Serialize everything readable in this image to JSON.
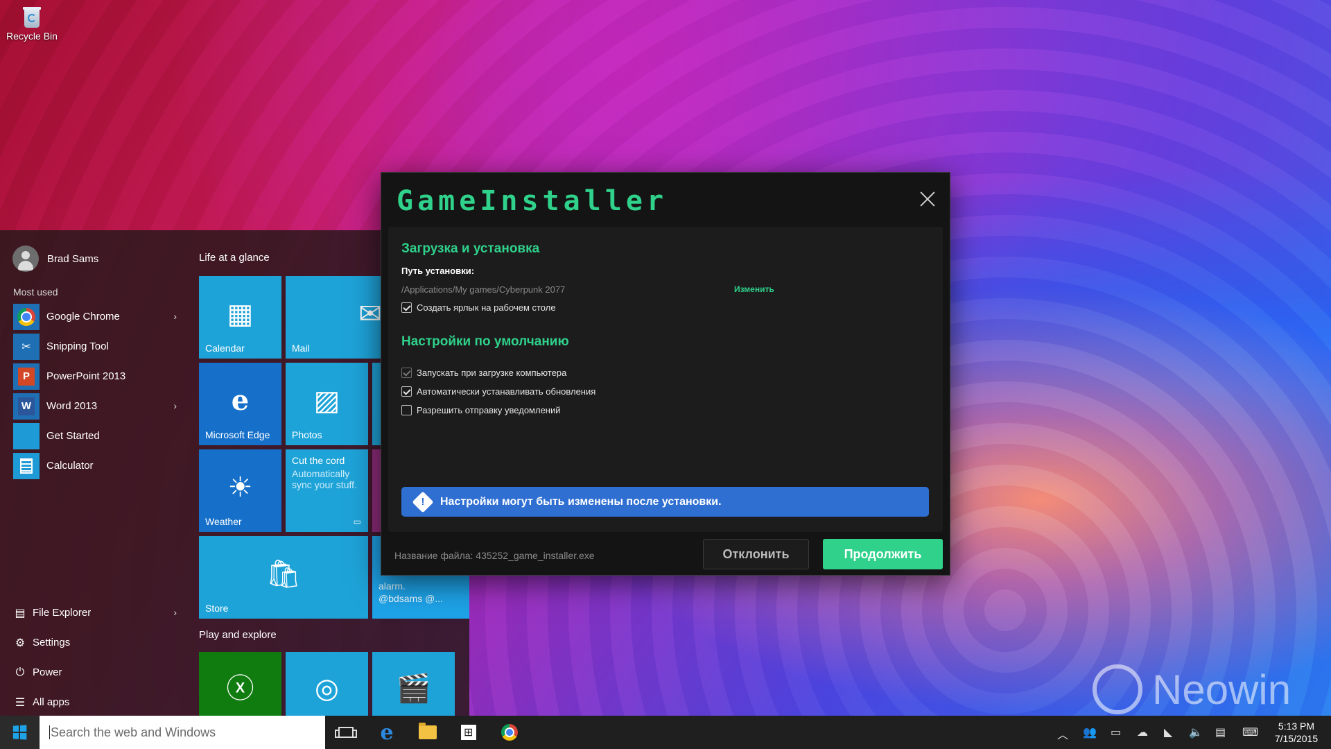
{
  "desktop": {
    "recycle_bin_label": "Recycle Bin",
    "watermark": "Neowin"
  },
  "start_menu": {
    "user_name": "Brad Sams",
    "most_used_label": "Most used",
    "most_used": [
      {
        "label": "Google Chrome",
        "icon": "chrome-icon",
        "has_submenu": true
      },
      {
        "label": "Snipping Tool",
        "icon": "snipping-tool-icon",
        "has_submenu": false
      },
      {
        "label": "PowerPoint 2013",
        "icon": "powerpoint-icon",
        "has_submenu": false
      },
      {
        "label": "Word 2013",
        "icon": "word-icon",
        "has_submenu": true
      },
      {
        "label": "Get Started",
        "icon": "get-started-icon",
        "has_submenu": false
      },
      {
        "label": "Calculator",
        "icon": "calculator-icon",
        "has_submenu": false
      }
    ],
    "bottom_items": [
      {
        "label": "File Explorer",
        "icon": "file-explorer-icon"
      },
      {
        "label": "Settings",
        "icon": "gear-icon"
      },
      {
        "label": "Power",
        "icon": "power-icon"
      },
      {
        "label": "All apps",
        "icon": "list-icon"
      }
    ],
    "groups": {
      "life": "Life at a glance",
      "play": "Play and explore"
    },
    "tiles": {
      "calendar": "Calendar",
      "mail": "Mail",
      "edge": "Microsoft Edge",
      "photos": "Photos",
      "weather": "Weather",
      "cut_cord_title": "Cut the cord",
      "cut_cord_text": "Automatically sync your stuff.",
      "store": "Store",
      "twitter_line1": "alarm.",
      "twitter_line2": "@bdsams @..."
    }
  },
  "dialog": {
    "title": "GameInstaller",
    "section1_title": "Загрузка и установка",
    "path_label": "Путь установки:",
    "path_value": "/Applications/My games/Cyberpunk 2077",
    "change_link": "Изменить",
    "shortcut_label": "Создать ярлык на рабочем столе",
    "shortcut_checked": true,
    "section2_title": "Настройки по умолчанию",
    "options": [
      {
        "label": "Запускать при загрузке компьютера",
        "checked": true,
        "dimmed": true
      },
      {
        "label": "Автоматически устанавливать обновления",
        "checked": true,
        "dimmed": false
      },
      {
        "label": "Разрешить отправку уведомлений",
        "checked": false,
        "dimmed": false
      }
    ],
    "info_text": "Настройки могут быть изменены после установки.",
    "file_name": "Название файла: 435252_game_installer.exe",
    "decline_label": "Отклонить",
    "continue_label": "Продолжить",
    "accent_color": "#2fd18b",
    "info_color": "#2f6fd1"
  },
  "taskbar": {
    "search_placeholder": "Search the web and Windows",
    "time": "5:13 PM",
    "date": "7/15/2015"
  }
}
